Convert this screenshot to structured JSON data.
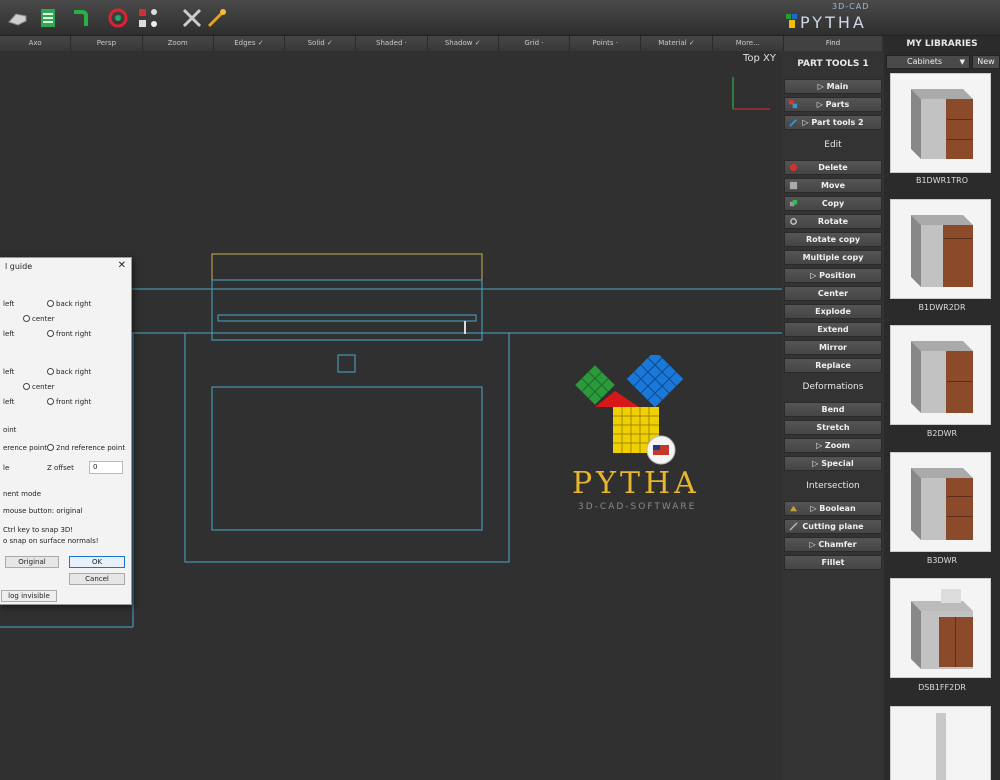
{
  "app": {
    "brand_sub": "3D-CAD",
    "brand_main": "PYTHA"
  },
  "viewbar": {
    "items": [
      "Axo",
      "Persp",
      "Zoom",
      "Edges ✓",
      "Solid ✓",
      "Shaded ·",
      "Shadow ✓",
      "Grid ·",
      "Points ·",
      "Material ✓",
      "More..."
    ],
    "find": "Find"
  },
  "viewport": {
    "view_label": "Top  XY"
  },
  "logo": {
    "word": "PYTHA",
    "tagline": "3D-CAD-SOFTWARE",
    "badge": "U.S.A. DEALER"
  },
  "dialog": {
    "title": "l guide",
    "close": "✕",
    "r1_left": "left",
    "r1_back_right": "back right",
    "r1_center": "center",
    "r1_left2": "left",
    "r1_front_right": "front right",
    "r2_left": "left",
    "r2_back_right": "back right",
    "r2_center": "center",
    "r2_left2": "left",
    "r2_front_right": "front right",
    "point_label": "oint",
    "ref1": "erence point",
    "ref2": "2nd reference point",
    "angle_label": "le",
    "z_offset_label": "Z offset",
    "z_offset_value": "0",
    "mode_label": "nent mode",
    "mouse_text": "mouse button: original",
    "ctrl_text1": "Ctrl key to snap 3D!",
    "ctrl_text2": "o snap on surface normals!",
    "btn_original": "Original",
    "btn_ok": "OK",
    "btn_cancel": "Cancel",
    "invisible": "log invisible"
  },
  "tools": {
    "title": "PART TOOLS 1",
    "nav": [
      "▷ Main",
      "▷ Parts",
      "▷ Part tools 2"
    ],
    "edit_head": "Edit",
    "edit": [
      "Delete",
      "Move",
      "Copy",
      "Rotate",
      "Rotate copy",
      "Multiple copy",
      "▷ Position",
      "Center",
      "Explode",
      "Extend",
      "Mirror",
      "Replace"
    ],
    "deform_head": "Deformations",
    "deform": [
      "Bend",
      "Stretch",
      "▷ Zoom",
      "▷ Special"
    ],
    "inter_head": "Intersection",
    "inter": [
      "▷ Boolean",
      "Cutting plane",
      "▷ Chamfer",
      "Fillet"
    ]
  },
  "libraries": {
    "title": "MY LIBRARIES",
    "selected": "Cabinets",
    "new": "New",
    "items": [
      "B1DWR1TRO",
      "B1DWR2DR",
      "B2DWR",
      "B3DWR",
      "DSB1FF2DR",
      ""
    ]
  }
}
